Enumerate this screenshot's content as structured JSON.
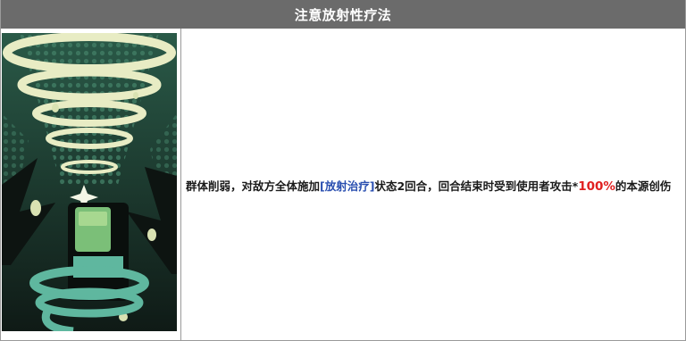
{
  "skill": {
    "title": "注意放射性疗法",
    "icon": "radiation-beacon-art",
    "description": {
      "part1": "群体削弱，对敌方全体施加",
      "status_link": "[放射治疗]",
      "part2": "状态2回合，回合结束时受到使用者攻击*",
      "value": "100%",
      "part3": "的本源创伤"
    }
  },
  "colors": {
    "header_bg": "#6b6b6b",
    "link": "#2a4fb0",
    "highlight": "#e02020"
  }
}
